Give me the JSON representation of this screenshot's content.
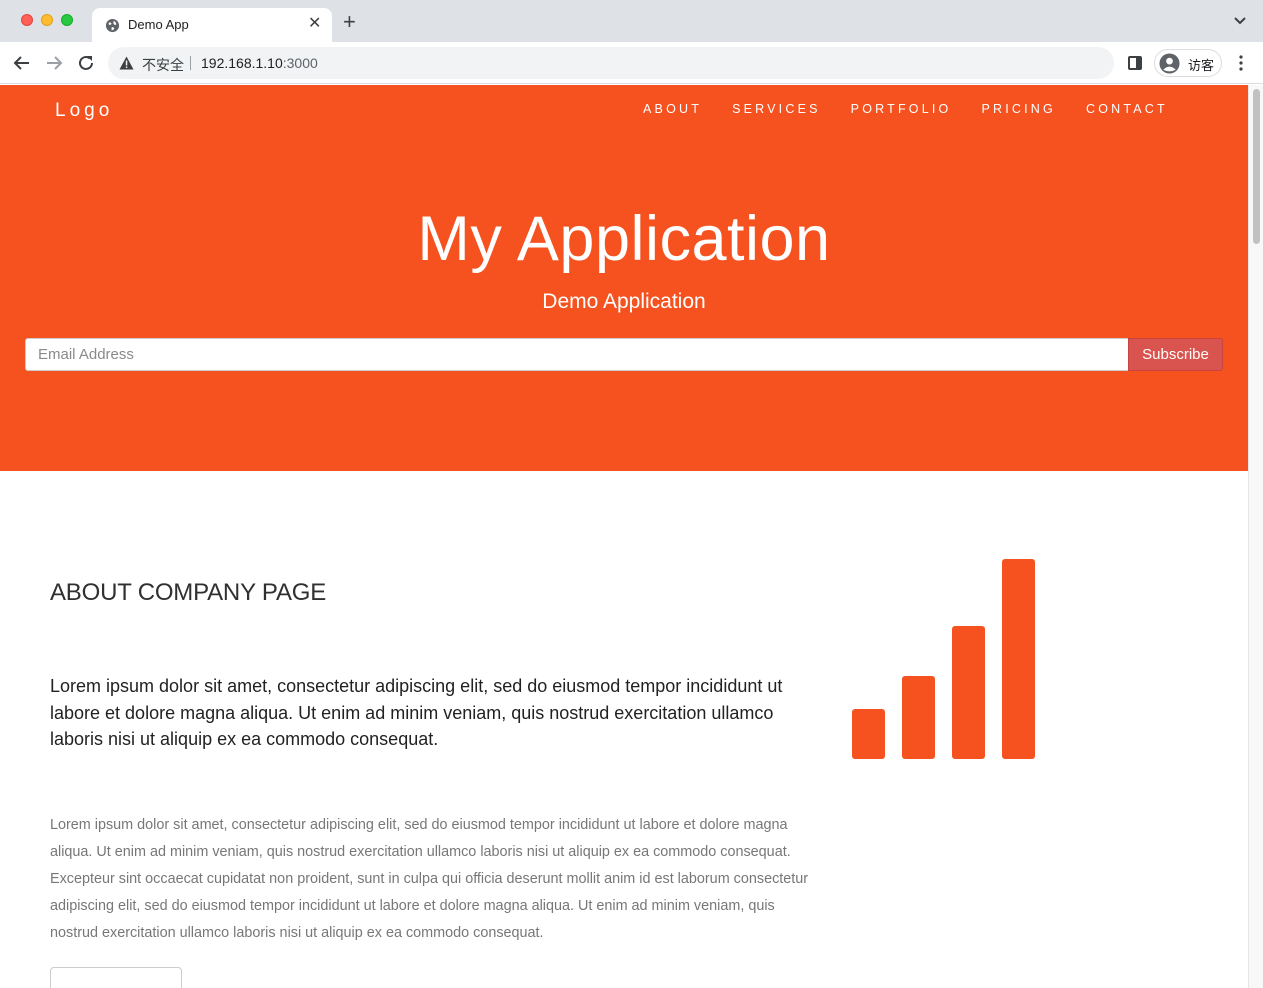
{
  "browser": {
    "tab_title": "Demo App",
    "security_label": "不安全",
    "url_host": "192.168.1.10",
    "url_port": ":3000",
    "profile_label": "访客"
  },
  "nav": {
    "logo": "Logo",
    "links": [
      "ABOUT",
      "SERVICES",
      "PORTFOLIO",
      "PRICING",
      "CONTACT"
    ]
  },
  "hero": {
    "title": "My Application",
    "subtitle": "Demo Application",
    "email_placeholder": "Email Address",
    "subscribe_label": "Subscribe"
  },
  "about": {
    "heading": "ABOUT COMPANY PAGE",
    "lead": "Lorem ipsum dolor sit amet, consectetur adipiscing elit, sed do eiusmod tempor incididunt ut labore et dolore magna aliqua. Ut enim ad minim veniam, quis nostrud exercitation ullamco laboris nisi ut aliquip ex ea commodo consequat.",
    "body": "Lorem ipsum dolor sit amet, consectetur adipiscing elit, sed do eiusmod tempor incididunt ut labore et dolore magna aliqua. Ut enim ad minim veniam, quis nostrud exercitation ullamco laboris nisi ut aliquip ex ea commodo consequat. Excepteur sint occaecat cupidatat non proident, sunt in culpa qui officia deserunt mollit anim id est laborum consectetur adipiscing elit, sed do eiusmod tempor incididunt ut labore et dolore magna aliqua. Ut enim ad minim veniam, quis nostrud exercitation ullamco laboris nisi ut aliquip ex ea commodo consequat.",
    "icon": "signal-bars-icon"
  },
  "colors": {
    "brand": "#f55220",
    "subscribe": "#d9534f"
  }
}
